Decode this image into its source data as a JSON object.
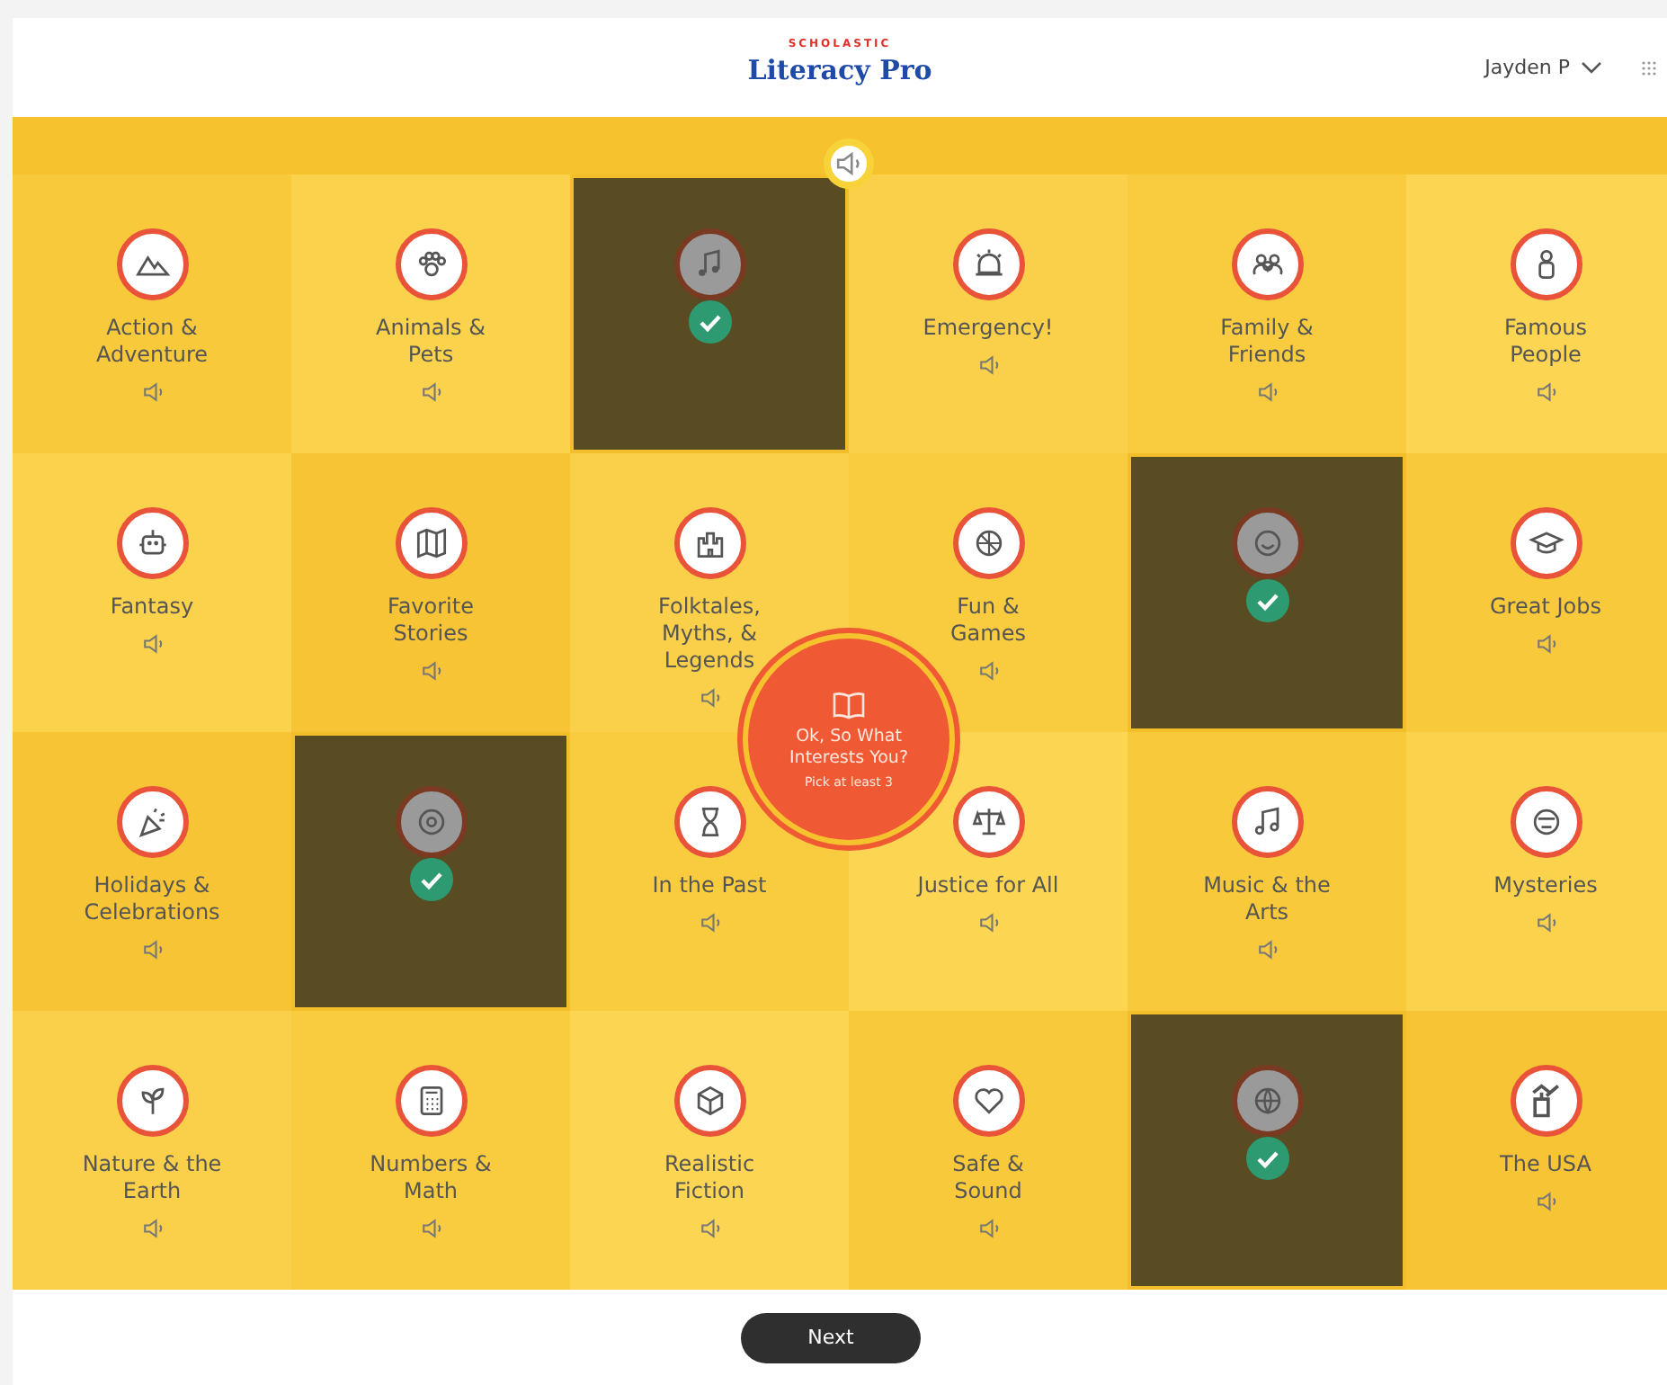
{
  "header": {
    "brand_top": "SCHOLASTIC",
    "brand": "Literacy Pro",
    "user": "Jayden P"
  },
  "prompt": {
    "title": "Ok, So What Interests You?",
    "hint": "Pick at least 3"
  },
  "tiles": [
    {
      "label": "Action & Adventure",
      "selected": false
    },
    {
      "label": "Animals & Pets",
      "selected": false
    },
    {
      "selected": true
    },
    {
      "label": "Emergency!",
      "selected": false
    },
    {
      "label": "Family & Friends",
      "selected": false
    },
    {
      "label": "Famous People",
      "selected": false
    },
    {
      "label": "Fantasy",
      "selected": false
    },
    {
      "label": "Favorite Stories",
      "selected": false
    },
    {
      "label": "Folktales, Myths, & Legends",
      "selected": false
    },
    {
      "label": "Fun & Games",
      "selected": false
    },
    {
      "selected": true
    },
    {
      "label": "Great Jobs",
      "selected": false
    },
    {
      "label": "Holidays & Celebrations",
      "selected": false
    },
    {
      "selected": true
    },
    {
      "label": "In the Past",
      "selected": false
    },
    {
      "label": "Justice for All",
      "selected": false
    },
    {
      "label": "Music & the Arts",
      "selected": false
    },
    {
      "label": "Mysteries",
      "selected": false
    },
    {
      "label": "Nature & the Earth",
      "selected": false
    },
    {
      "label": "Numbers & Math",
      "selected": false
    },
    {
      "label": "Realistic Fiction",
      "selected": false
    },
    {
      "label": "Safe & Sound",
      "selected": false
    },
    {
      "selected": true
    },
    {
      "label": "The USA",
      "selected": false
    }
  ],
  "footer": {
    "button": "Next"
  }
}
